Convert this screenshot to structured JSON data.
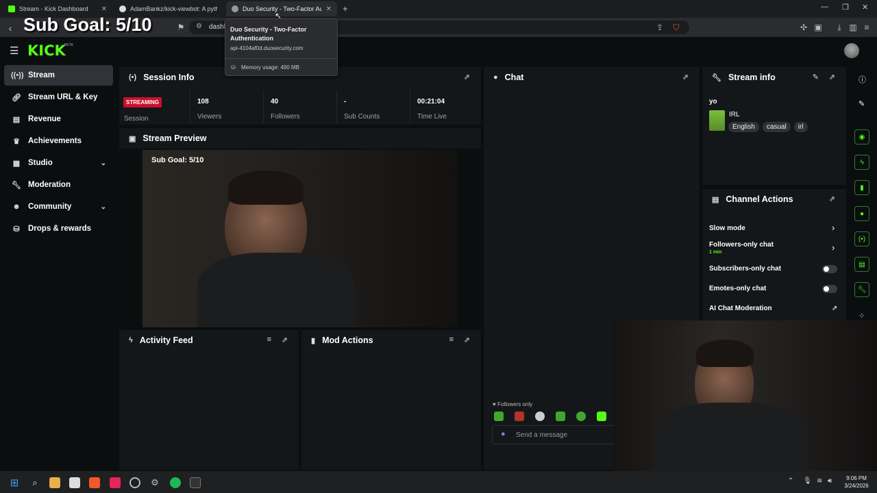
{
  "browser": {
    "tabs": [
      {
        "title": "Stream - Kick Dashboard",
        "active": false
      },
      {
        "title": "AdamBankz/kick-viewbot: A python",
        "active": false
      },
      {
        "title": "Duo Security - Two-Factor Authe",
        "active": true
      }
    ],
    "new_tab": "+",
    "address": "dashb",
    "tooltip": {
      "title": "Duo Security - Two-Factor Authentication",
      "url": "api-4104af0d.duosecurity.com",
      "memory": "Memory usage: 490 MB"
    }
  },
  "overlay": {
    "sub_goal": "Sub Goal: 5/10"
  },
  "brand": {
    "logo": "KICK",
    "badge": "BETA"
  },
  "sidebar": {
    "items": [
      {
        "label": "Stream",
        "icon": "broadcast-icon"
      },
      {
        "label": "Stream URL & Key",
        "icon": "link-icon"
      },
      {
        "label": "Revenue",
        "icon": "chart-icon"
      },
      {
        "label": "Achievements",
        "icon": "trophy-icon"
      },
      {
        "label": "Studio",
        "icon": "studio-icon"
      },
      {
        "label": "Moderation",
        "icon": "wrench-icon"
      },
      {
        "label": "Community",
        "icon": "users-icon"
      },
      {
        "label": "Drops & rewards",
        "icon": "gift-icon"
      }
    ]
  },
  "session": {
    "title": "Session Info",
    "status": "STREAMING",
    "status_label": "Session",
    "stats": [
      {
        "value": "108",
        "label": "Viewers"
      },
      {
        "value": "40",
        "label": "Followers"
      },
      {
        "value": "-",
        "label": "Sub Counts"
      },
      {
        "value": "00:21:04",
        "label": "Time Live"
      }
    ]
  },
  "preview": {
    "title": "Stream Preview",
    "overlay_text": "Sub Goal: 5/10"
  },
  "activity": {
    "title": "Activity Feed"
  },
  "mod": {
    "title": "Mod Actions"
  },
  "chat": {
    "title": "Chat",
    "followers_only": "Followers only",
    "placeholder": "Send a message"
  },
  "stream_info": {
    "title": "Stream info",
    "stream_title": "yo",
    "category": "IRL",
    "tags": [
      "English",
      "casual",
      "irl"
    ]
  },
  "channel_actions": {
    "title": "Channel Actions",
    "slow_mode": "Slow mode",
    "followers_only": "Followers-only chat",
    "followers_only_value": "1 min",
    "subscribers_only": "Subscribers-only chat",
    "emotes_only": "Emotes-only chat",
    "ai_moderation": "AI Chat Moderation"
  },
  "taskbar": {
    "time": "9:06 PM",
    "date": "3/24/2026"
  },
  "colors": {
    "kick_green": "#53fc18",
    "streaming_red": "#c8102e",
    "panel_bg": "#141719"
  }
}
